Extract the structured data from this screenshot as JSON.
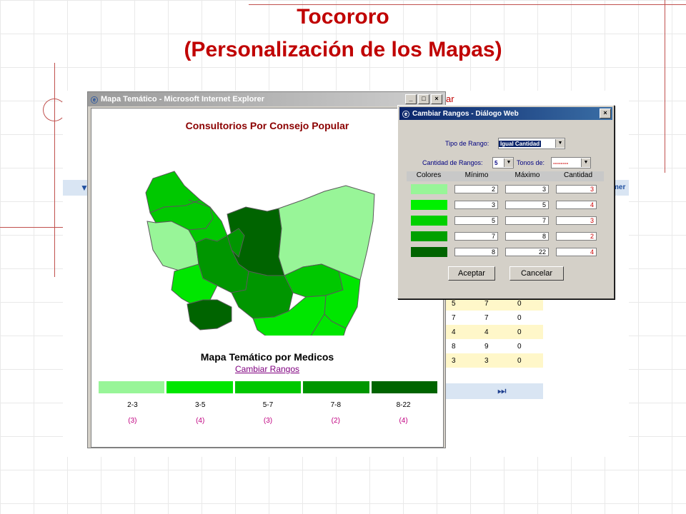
{
  "slide": {
    "title_line1": "Tocororo",
    "title_line2": "(Personalización de los Mapas)"
  },
  "background_app": {
    "partial_text_top": "ar",
    "partial_text_right": "mer",
    "table_rows": [
      [
        "5",
        "7",
        "0"
      ],
      [
        "7",
        "7",
        "0"
      ],
      [
        "4",
        "4",
        "0"
      ],
      [
        "8",
        "9",
        "0"
      ],
      [
        "3",
        "3",
        "0"
      ]
    ],
    "nav_glyph": "⏭"
  },
  "ie_window": {
    "title": "Mapa Temático - Microsoft Internet Explorer",
    "buttons": [
      "_",
      "□",
      "×"
    ],
    "map_title": "Consultorios Por Consejo Popular",
    "legend_title": "Mapa Temático por Medicos",
    "change_link": "Cambiar Rangos",
    "legend": {
      "colors": [
        "#98f598",
        "#00e600",
        "#00c800",
        "#009600",
        "#006400"
      ],
      "ranges": [
        "2-3",
        "3-5",
        "5-7",
        "7-8",
        "8-22"
      ],
      "counts": [
        "(3)",
        "(4)",
        "(3)",
        "(2)",
        "(4)"
      ]
    }
  },
  "dialog": {
    "title": "Cambiar Rangos - Diálogo Web",
    "close": "×",
    "tipo_label": "Tipo de Rango:",
    "tipo_value": "Igual Cantidad",
    "cantidad_label": "Cantidad de Rangos:",
    "cantidad_value": "5",
    "tonos_label": "Tonos de:",
    "tonos_value": "--------",
    "headers": [
      "Colores",
      "Mínimo",
      "Máximo",
      "Cantidad"
    ],
    "rows": [
      {
        "color": "#98f598",
        "min": "2",
        "max": "3",
        "count": "3"
      },
      {
        "color": "#00f000",
        "min": "3",
        "max": "5",
        "count": "4"
      },
      {
        "color": "#00d000",
        "min": "5",
        "max": "7",
        "count": "3"
      },
      {
        "color": "#00a000",
        "min": "7",
        "max": "8",
        "count": "2"
      },
      {
        "color": "#006400",
        "min": "8",
        "max": "22",
        "count": "4"
      }
    ],
    "accept_label": "Aceptar",
    "cancel_label": "Cancelar"
  }
}
